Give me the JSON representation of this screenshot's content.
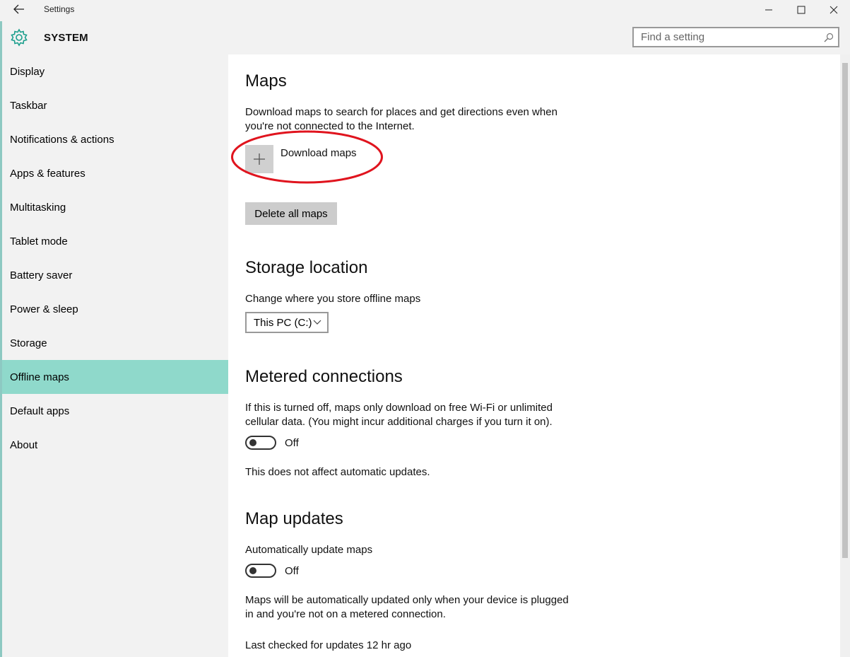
{
  "window": {
    "title": "Settings"
  },
  "header": {
    "section": "SYSTEM",
    "search_placeholder": "Find a setting"
  },
  "sidebar": {
    "items": [
      {
        "label": "Display"
      },
      {
        "label": "Taskbar"
      },
      {
        "label": "Notifications & actions"
      },
      {
        "label": "Apps & features"
      },
      {
        "label": "Multitasking"
      },
      {
        "label": "Tablet mode"
      },
      {
        "label": "Battery saver"
      },
      {
        "label": "Power & sleep"
      },
      {
        "label": "Storage"
      },
      {
        "label": "Offline maps"
      },
      {
        "label": "Default apps"
      },
      {
        "label": "About"
      }
    ],
    "active": "Offline maps"
  },
  "content": {
    "maps": {
      "title": "Maps",
      "description": "Download maps to search for places and get directions even when you're not connected to the Internet.",
      "download_label": "Download maps",
      "delete_label": "Delete all maps"
    },
    "storage": {
      "title": "Storage location",
      "description": "Change where you store offline maps",
      "selected": "This PC (C:)"
    },
    "metered": {
      "title": "Metered connections",
      "description": "If this is turned off, maps only download on free Wi-Fi or unlimited cellular data. (You might incur additional charges if you turn it on).",
      "toggle_state": "Off",
      "note": "This does not affect automatic updates."
    },
    "updates": {
      "title": "Map updates",
      "description": "Automatically update maps",
      "toggle_state": "Off",
      "note": "Maps will be automatically updated only when your device is plugged in and you're not on a metered connection.",
      "last_checked": "Last checked for updates 12 hr ago"
    }
  },
  "colors": {
    "accent": "#8fd9cb",
    "annotation": "#e0141e"
  },
  "icons": [
    "back-arrow-icon",
    "minimize-icon",
    "maximize-icon",
    "close-icon",
    "gear-icon",
    "search-icon",
    "plus-icon",
    "chevron-down-icon"
  ]
}
